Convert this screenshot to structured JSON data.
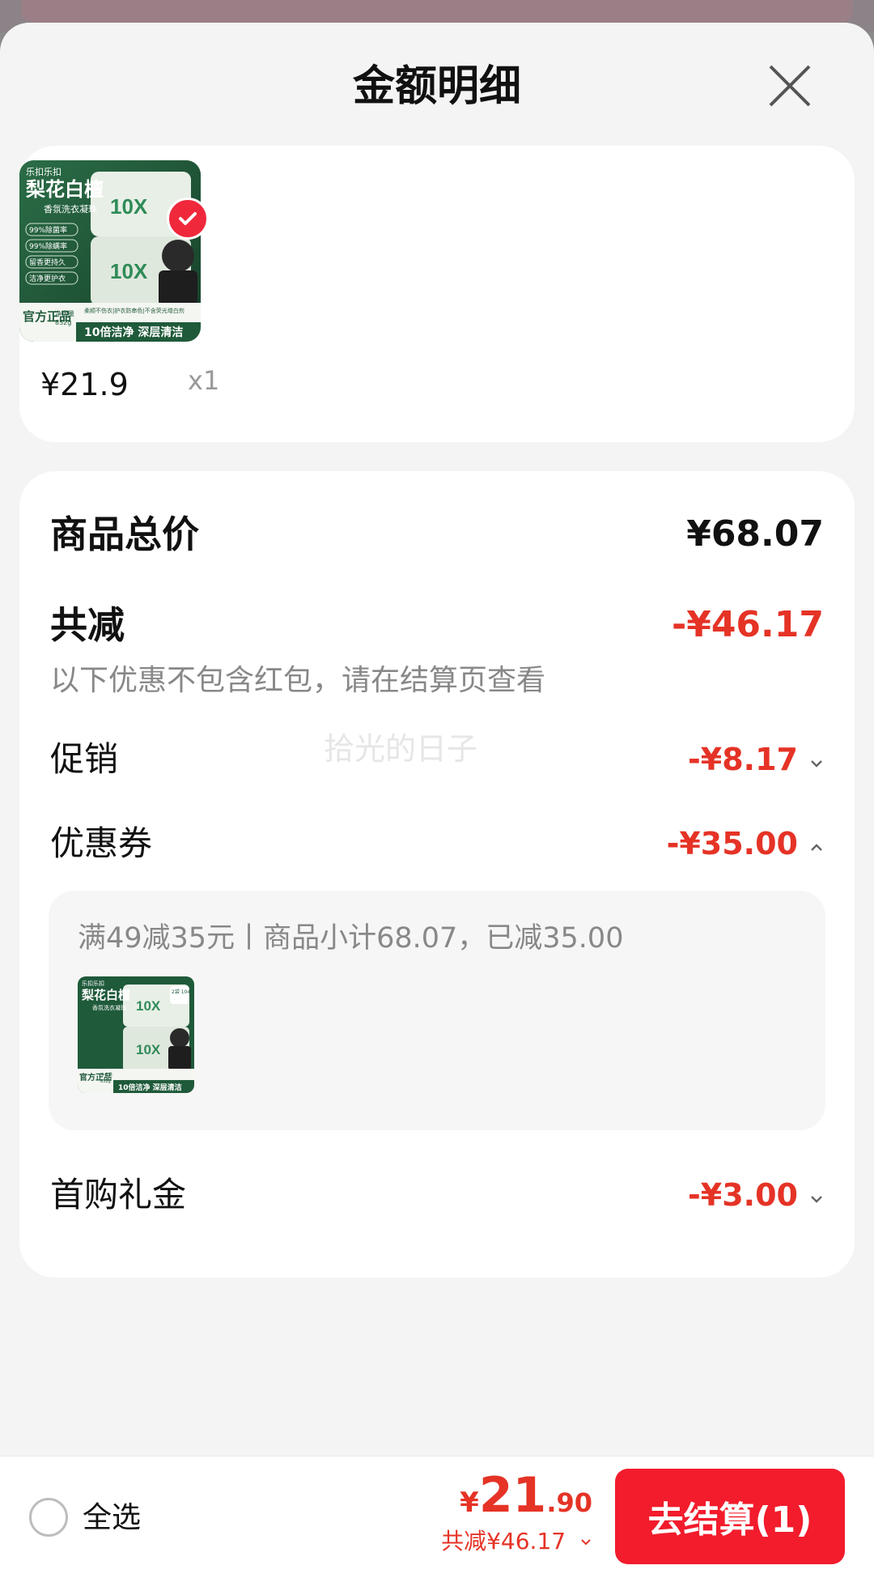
{
  "sheet": {
    "title": "金额明细",
    "close_icon": "close-icon"
  },
  "product_card": {
    "items": [
      {
        "name": "乐扣乐扣 梨花白檀 香氛洗衣凝珠",
        "price": "¥21.9",
        "qty": "x1",
        "selected": true,
        "image_texts": {
          "brand": "乐扣乐扣",
          "title": "梨花白檀",
          "subtitle": "香氛洗衣凝珠",
          "tags": [
            "99%除菌率",
            "99%除螨率",
            "留香更持久",
            "洁净更护衣"
          ],
          "official": "官方正品",
          "net": "净含量",
          "weight": "832g",
          "slogan": "10倍洁净 深层清洁",
          "banner": "柔顺不伤衣|护衣防串色|不含荧光增白剂",
          "badge": "10X"
        }
      }
    ]
  },
  "detail": {
    "total_label": "商品总价",
    "total_value": "¥68.07",
    "reduce_label": "共减",
    "reduce_value": "-¥46.17",
    "reduce_note": "以下优惠不包含红包，请在结算页查看",
    "watermark": "拾光的日子",
    "promo_label": "促销",
    "promo_value": "-¥8.17",
    "coupon_label": "优惠券",
    "coupon_value": "-¥35.00",
    "coupon_desc": "满49减35元丨商品小计68.07，已减35.00",
    "coupon_thumb_texts": {
      "brand": "乐扣乐扣",
      "title": "梨花白檀",
      "subtitle": "香氛洗衣凝珠",
      "badge": "2袋 104颗",
      "official": "官方正品",
      "net": "净含量",
      "weight": "832g",
      "slogan": "10倍洁净 深层清洁"
    },
    "gift_label": "首购礼金",
    "gift_value": "-¥3.00"
  },
  "bottom_bar": {
    "select_all": "全选",
    "total_yen": "¥",
    "total_int": "21",
    "total_dec": ".90",
    "saved": "共减¥46.17",
    "checkout": "去结算(1)"
  },
  "colors": {
    "accent_red": "#e53326",
    "checkout_red": "#f21c2c",
    "sheet_bg": "#f4f4f4",
    "card_bg": "#ffffff",
    "product_green": "#1f5a3a"
  }
}
